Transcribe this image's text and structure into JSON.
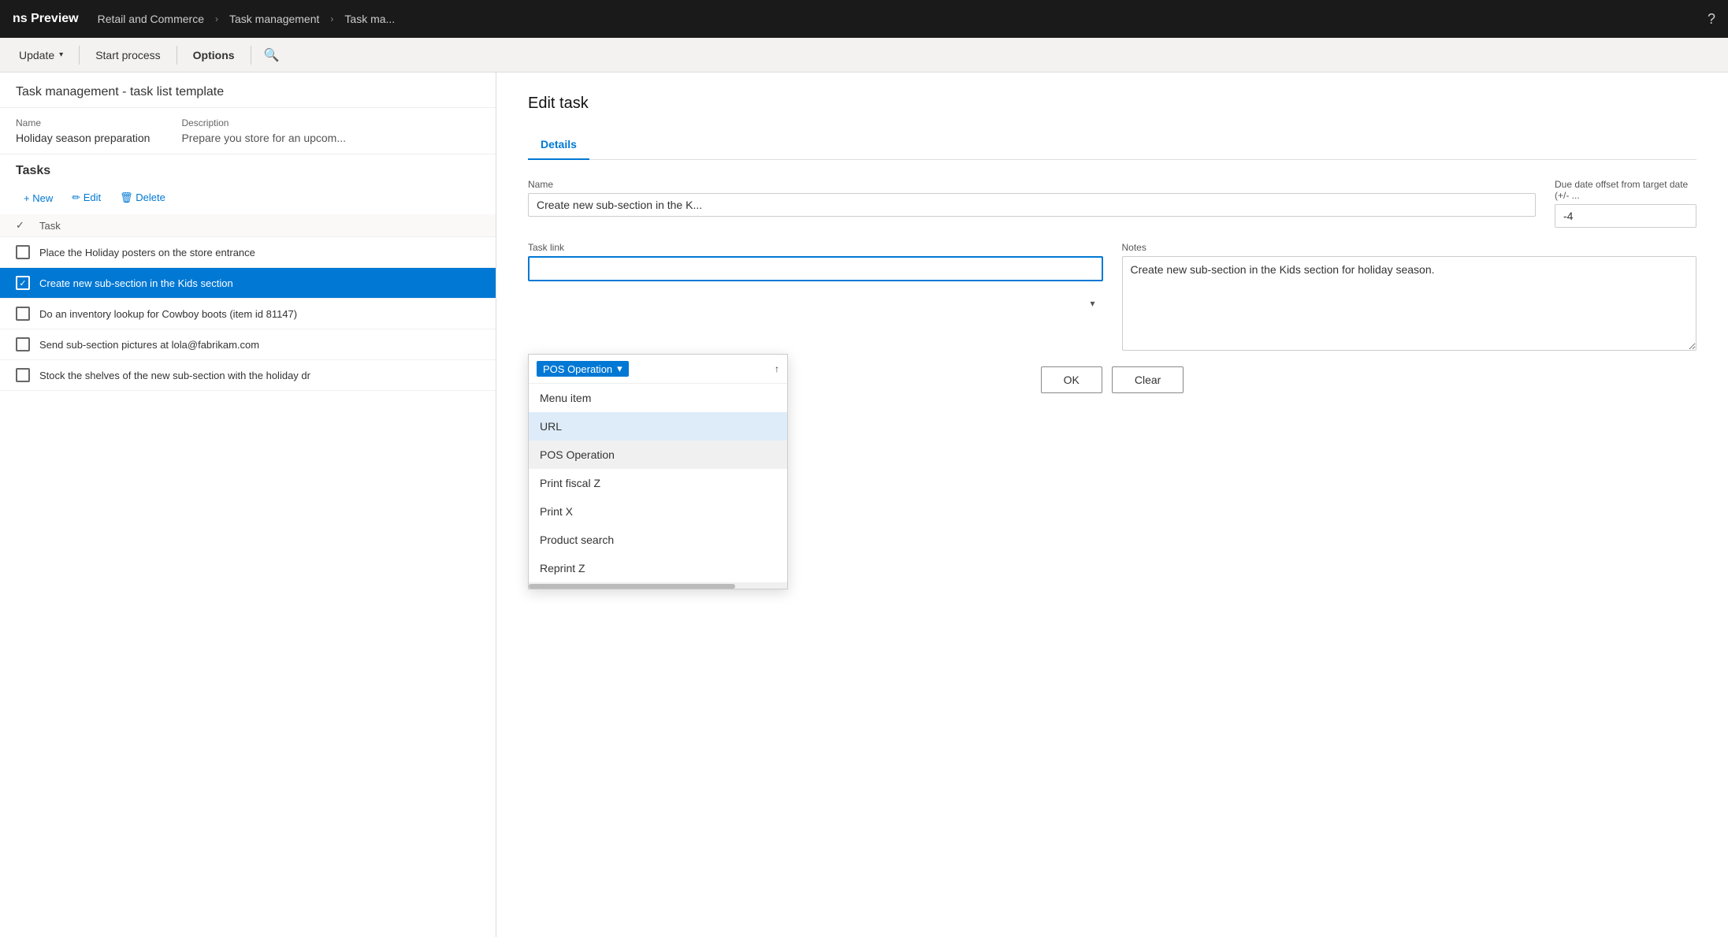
{
  "topNav": {
    "appName": "ns Preview",
    "breadcrumbs": [
      {
        "label": "Retail and Commerce"
      },
      {
        "label": "Task management"
      },
      {
        "label": "Task ma..."
      }
    ],
    "helpIcon": "?"
  },
  "toolbar": {
    "updateLabel": "Update",
    "updateChevron": "▾",
    "startProcessLabel": "Start process",
    "optionsLabel": "Options",
    "searchIcon": "🔍"
  },
  "pageHeader": {
    "title": "Task management - task list template"
  },
  "fields": {
    "nameLabel": "Name",
    "nameValue": "Holiday season preparation",
    "descriptionLabel": "Description",
    "descriptionValue": "Prepare you store for an upcom..."
  },
  "tasks": {
    "sectionTitle": "Tasks",
    "newLabel": "+ New",
    "editLabel": "✏ Edit",
    "deleteLabel": "🗑 Delete",
    "columnHeader": "Task",
    "items": [
      {
        "id": 1,
        "name": "Place the Holiday posters on the store entrance",
        "checked": false,
        "selected": false
      },
      {
        "id": 2,
        "name": "Create new sub-section in the Kids section",
        "checked": true,
        "selected": true
      },
      {
        "id": 3,
        "name": "Do an inventory lookup for Cowboy boots (item id 81147)",
        "checked": false,
        "selected": false
      },
      {
        "id": 4,
        "name": "Send sub-section pictures at lola@fabrikam.com",
        "checked": false,
        "selected": false
      },
      {
        "id": 5,
        "name": "Stock the shelves of the new sub-section with the holiday dr",
        "checked": false,
        "selected": false
      }
    ]
  },
  "editTask": {
    "title": "Edit task",
    "tabs": [
      {
        "label": "Details",
        "active": true
      }
    ],
    "nameLabel": "Name",
    "nameValue": "Create new sub-section in the K...",
    "dueDateLabel": "Due date offset from target date (+/- ...",
    "dueDateValue": "-4",
    "taskLinkLabel": "Task link",
    "taskLinkValue": "",
    "notesLabel": "Notes",
    "notesValue": "Create new sub-section in the Kids section for holiday season.",
    "dropdown": {
      "selectedLabel": "POS Operation",
      "items": [
        {
          "label": "Menu item",
          "highlighted": false
        },
        {
          "label": "URL",
          "highlighted": true
        },
        {
          "label": "POS Operation",
          "highlighted": false,
          "isSelected": true
        },
        {
          "label": "Print fiscal Z",
          "highlighted": false
        },
        {
          "label": "Print X",
          "highlighted": false
        },
        {
          "label": "Product search",
          "highlighted": false
        },
        {
          "label": "Reprint Z",
          "highlighted": false
        }
      ]
    },
    "okLabel": "OK",
    "clearLabel": "Clear"
  }
}
